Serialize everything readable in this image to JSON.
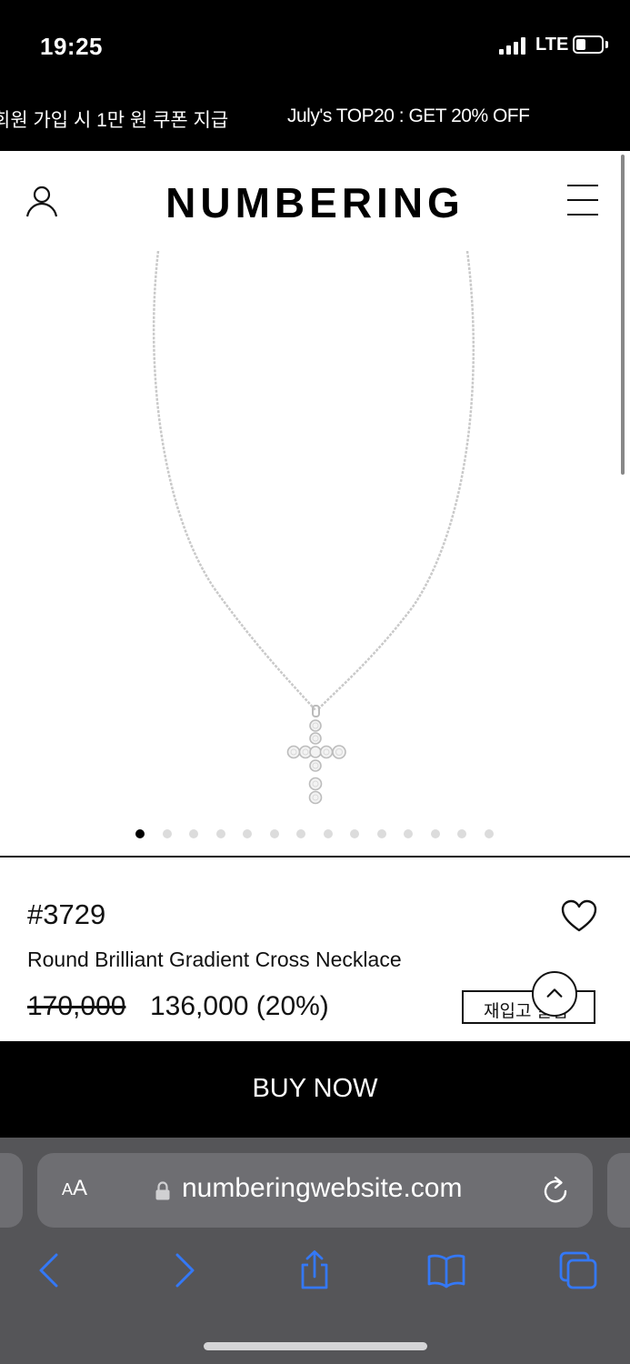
{
  "status_bar": {
    "time": "19:25",
    "network": "LTE"
  },
  "promo": {
    "items": [
      "회원 가입 시 1만 원 쿠폰 지급",
      "July's TOP20 : GET 20% OFF"
    ]
  },
  "header": {
    "logo": "NUMBERING"
  },
  "gallery": {
    "image_count": 14,
    "active_index": 0
  },
  "product": {
    "code": "#3729",
    "name": "Round Brilliant Gradient Cross Necklace",
    "price_original": "170,000",
    "price_sale": "136,000 (20%)",
    "restock_label": "재입고 알림"
  },
  "cta": {
    "buy_now": "BUY NOW"
  },
  "browser": {
    "text_size_label_small": "A",
    "text_size_label_large": "A",
    "url": "numberingwebsite.com"
  },
  "colors": {
    "accent": "#3478f6",
    "browser_bg": "#555558",
    "dark": "#000000"
  }
}
